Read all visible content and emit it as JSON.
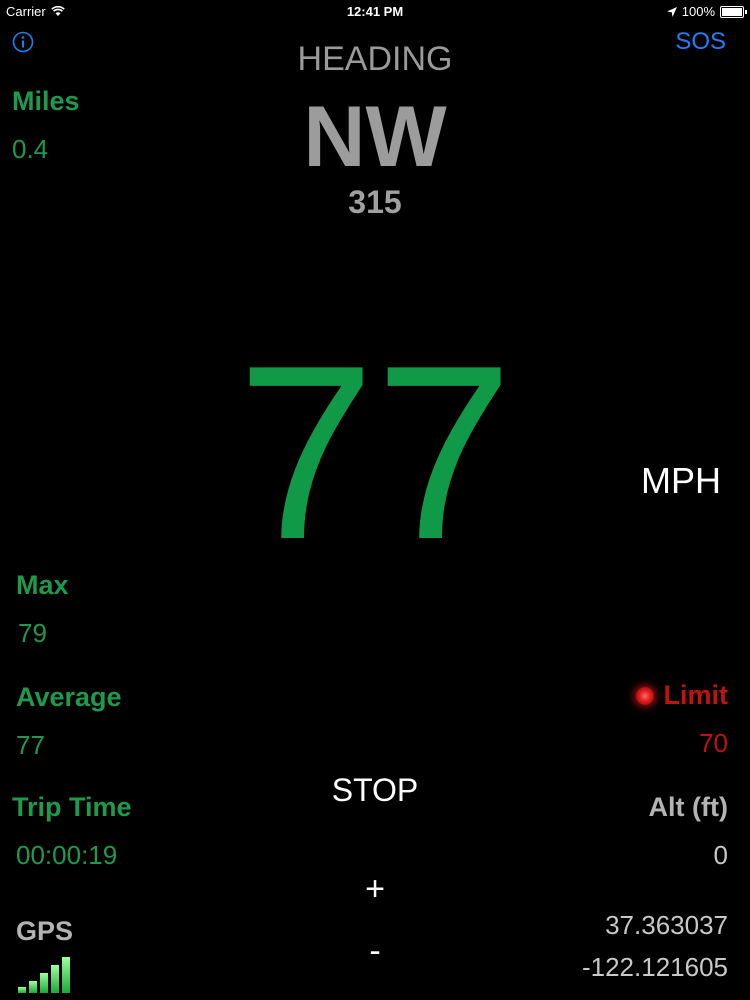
{
  "status_bar": {
    "carrier": "Carrier",
    "time": "12:41 PM",
    "battery": "100%",
    "icons": [
      "wifi-icon",
      "location-arrow-icon",
      "battery-icon"
    ]
  },
  "toolbar": {
    "info_icon": "info-icon",
    "sos_label": "SOS"
  },
  "heading": {
    "title": "HEADING",
    "direction": "NW",
    "degrees": "315"
  },
  "trip": {
    "miles_label": "Miles",
    "miles_value": "0.4",
    "max_label": "Max",
    "max_value": "79",
    "average_label": "Average",
    "average_value": "77",
    "trip_time_label": "Trip Time",
    "trip_time_value": "00:00:19"
  },
  "speed": {
    "value": "77",
    "unit": "MPH"
  },
  "limit": {
    "label": "Limit",
    "value": "70"
  },
  "altitude": {
    "label": "Alt (ft)",
    "value": "0"
  },
  "gps": {
    "label": "GPS",
    "latitude": "37.363037",
    "longitude": "-122.121605",
    "signal_icon": "signal-strength-icon"
  },
  "controls": {
    "stop_label": "STOP",
    "plus_label": "+",
    "minus_label": "-"
  },
  "colors": {
    "accent_green": "#1d9a4c",
    "speed_green": "#109947",
    "limit_red": "#c01212",
    "sos_blue": "#1f7ef6"
  }
}
